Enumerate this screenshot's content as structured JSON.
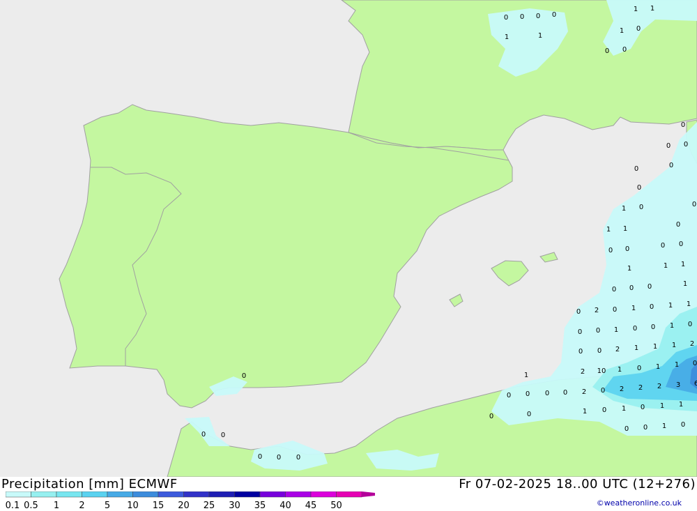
{
  "header": {
    "title_left": "Precipitation [mm] ECMWF",
    "title_right": "Fr 07-02-2025 18..00 UTC (12+276)",
    "credit": "©weatheronline.co.uk"
  },
  "legend": {
    "ticks": [
      "0.1",
      "0.5",
      "1",
      "2",
      "5",
      "10",
      "15",
      "20",
      "25",
      "30",
      "35",
      "40",
      "45",
      "50"
    ],
    "colors": [
      "#c8fafa",
      "#96f0f0",
      "#78e6f0",
      "#5ad2f0",
      "#46aae6",
      "#3c8cdc",
      "#3c5adc",
      "#3232c8",
      "#1e1eb4",
      "#0000a0",
      "#7800dc",
      "#aa00e6",
      "#dc00dc",
      "#e600b4",
      "#b4009a"
    ]
  },
  "map": {
    "colors": {
      "sea": "#ececec",
      "land": "#c4f7a0",
      "border": "#a0a0a0"
    },
    "point_labels": [
      "0",
      "0",
      "0",
      "0",
      "1",
      "1",
      "1",
      "1",
      "1",
      "0",
      "0",
      "0",
      "0",
      "0",
      "0",
      "0",
      "0",
      "0",
      "0",
      "1",
      "0",
      "1",
      "1",
      "0",
      "0",
      "0",
      "1",
      "0",
      "0",
      "1",
      "1",
      "1",
      "0",
      "0",
      "0",
      "0",
      "2",
      "0",
      "1",
      "0",
      "1",
      "1",
      "0",
      "0",
      "1",
      "0",
      "0",
      "1",
      "0",
      "0",
      "0",
      "2",
      "1",
      "1",
      "1",
      "2",
      "2",
      "10",
      "1",
      "0",
      "1",
      "1",
      "0",
      "2",
      "0",
      "2",
      "2",
      "2",
      "3",
      "6",
      "1",
      "0",
      "1",
      "0",
      "1",
      "1",
      "0",
      "0",
      "1",
      "0",
      "0",
      "0",
      "0",
      "0",
      "1",
      "0",
      "0",
      "0",
      "0",
      "0",
      "0",
      "0",
      "0"
    ]
  }
}
